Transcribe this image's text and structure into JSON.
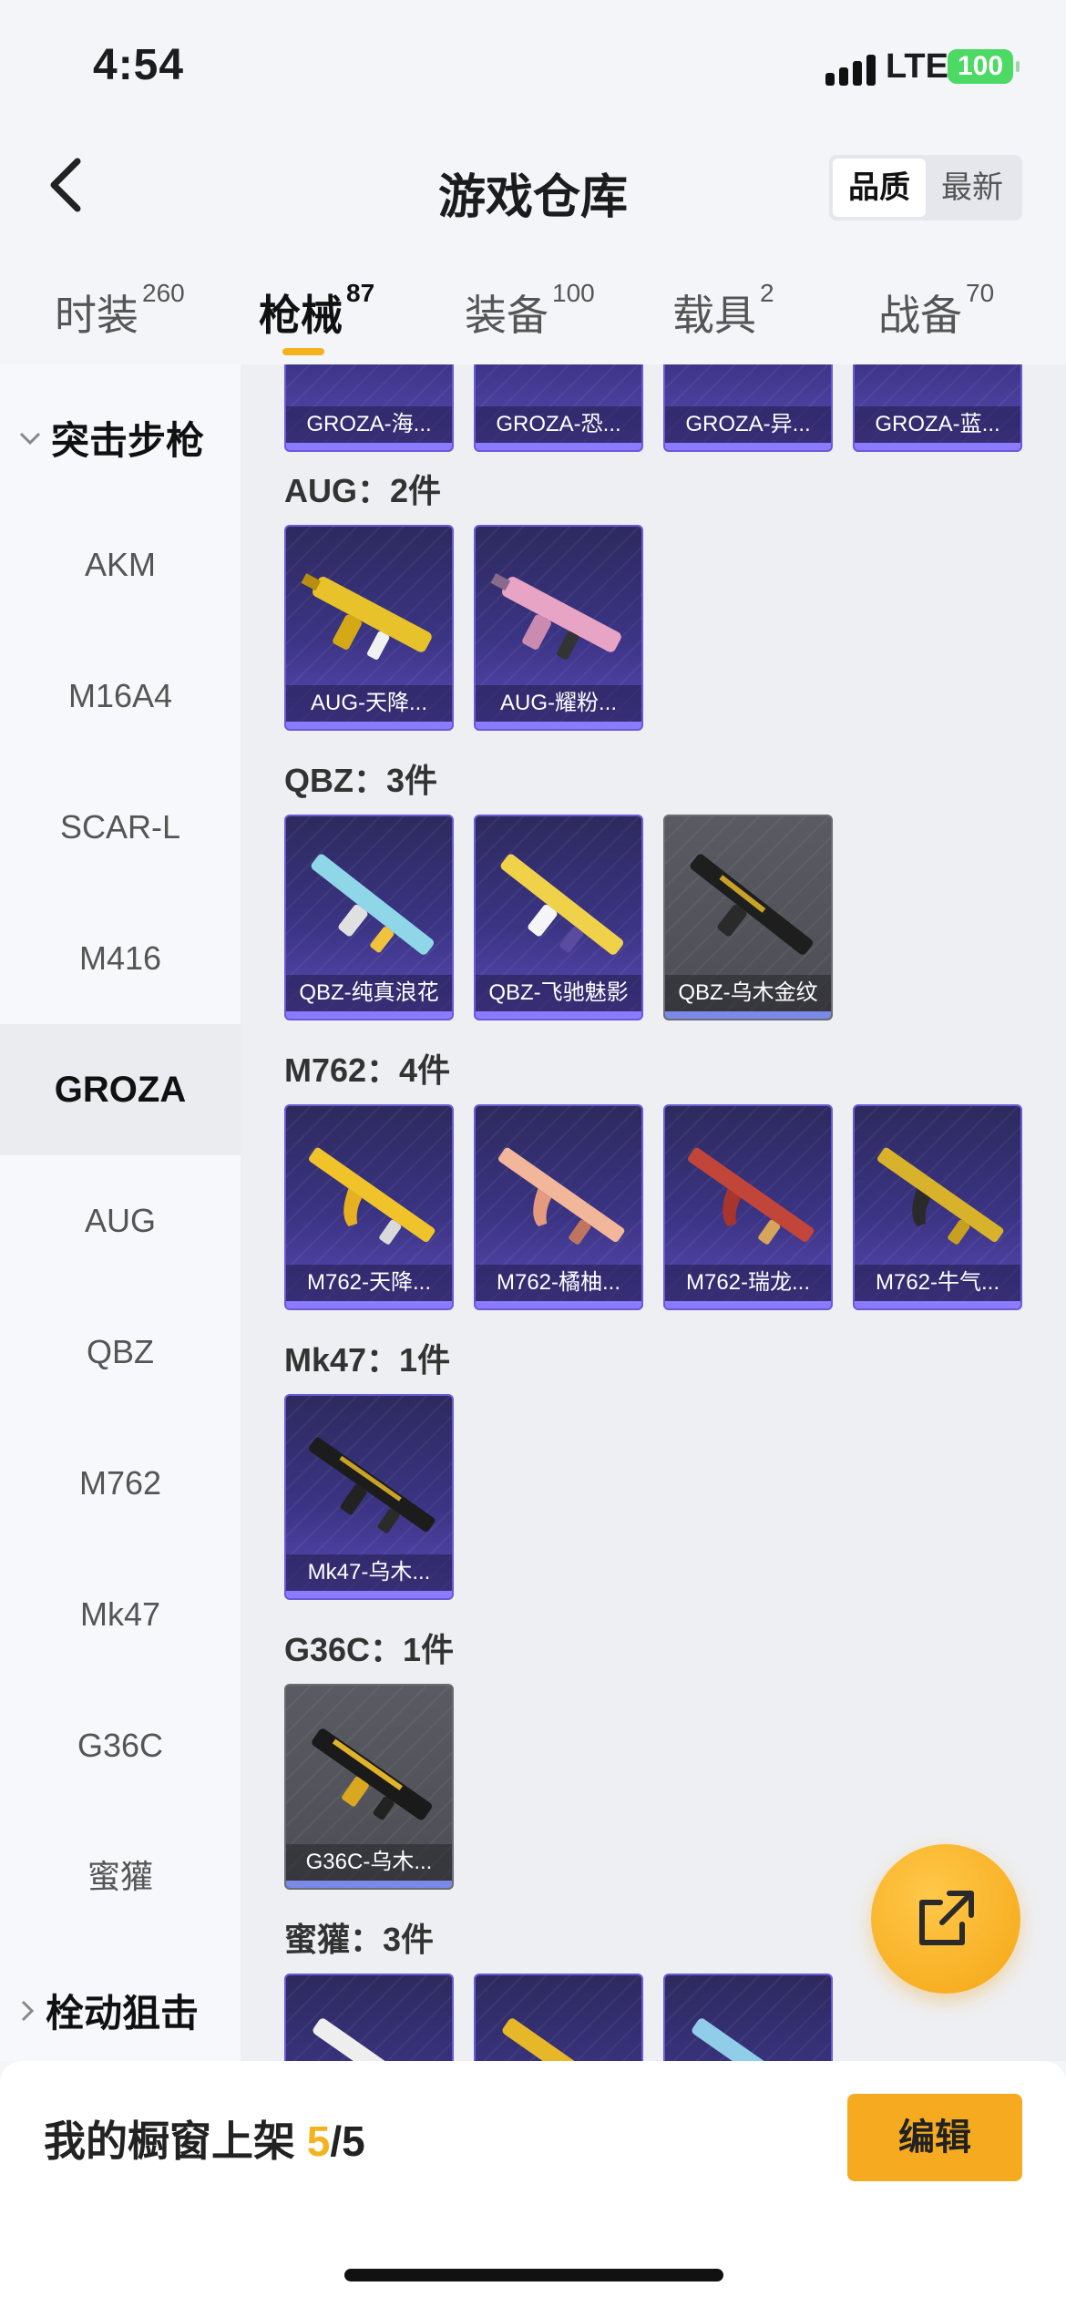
{
  "status": {
    "time": "4:54",
    "network": "LTE",
    "battery": "100"
  },
  "header": {
    "title": "游戏仓库",
    "sort_quality": "品质",
    "sort_newest": "最新"
  },
  "tabs": [
    {
      "label": "时装",
      "count": "260"
    },
    {
      "label": "枪械",
      "count": "87"
    },
    {
      "label": "装备",
      "count": "100"
    },
    {
      "label": "载具",
      "count": "2"
    },
    {
      "label": "战备",
      "count": "70"
    }
  ],
  "sidebar": {
    "group_assault": "突击步枪",
    "items": [
      "AKM",
      "M16A4",
      "SCAR-L",
      "M416",
      "GROZA",
      "AUG",
      "QBZ",
      "M762",
      "Mk47",
      "G36C",
      "蜜獾"
    ],
    "group_sniper": "栓动狙击"
  },
  "content": {
    "groza_cards": [
      "GROZA-海...",
      "GROZA-恐...",
      "GROZA-异...",
      "GROZA-蓝..."
    ],
    "aug_label": "AUG：2件",
    "aug_cards": [
      "AUG-天降...",
      "AUG-耀粉..."
    ],
    "qbz_label": "QBZ：3件",
    "qbz_cards": [
      "QBZ-纯真浪花",
      "QBZ-飞驰魅影",
      "QBZ-乌木金纹"
    ],
    "m762_label": "M762：4件",
    "m762_cards": [
      "M762-天降...",
      "M762-橘柚...",
      "M762-瑞龙...",
      "M762-牛气..."
    ],
    "mk47_label": "Mk47：1件",
    "mk47_cards": [
      "Mk47-乌木..."
    ],
    "g36c_label": "G36C：1件",
    "g36c_cards": [
      "G36C-乌木..."
    ],
    "honey_label": "蜜獾：3件"
  },
  "bottom": {
    "showcase_prefix": "我的橱窗上架",
    "showcase_count": "5",
    "showcase_total": "/5",
    "edit_label": "编辑"
  },
  "colors": {
    "accent": "#f5b21f",
    "card_purple": "#3b3484",
    "card_gray": "#4d4e55"
  }
}
